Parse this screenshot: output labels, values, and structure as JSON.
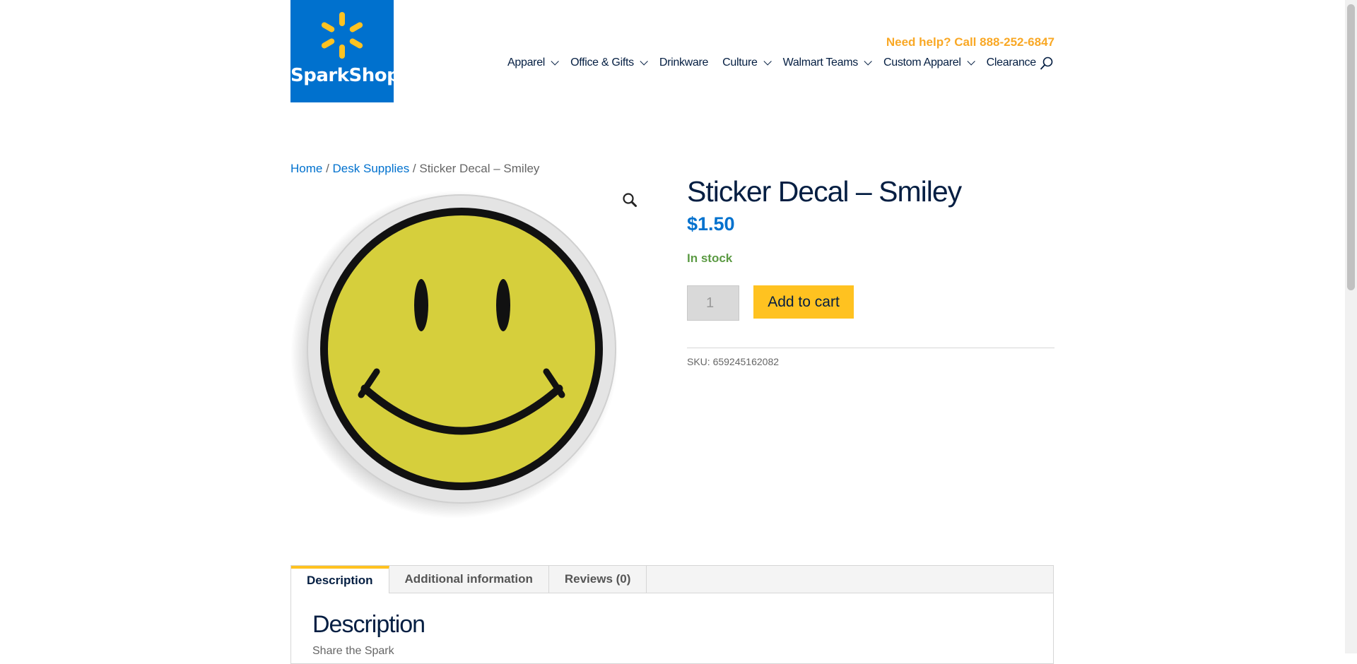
{
  "brand": {
    "name": "SparkShop",
    "color": "#0071ce",
    "spark_color": "#ffc220"
  },
  "header": {
    "help_text": "Need help? Call 888-252-6847",
    "nav": [
      {
        "label": "Apparel",
        "dropdown": true
      },
      {
        "label": "Office & Gifts",
        "dropdown": true
      },
      {
        "label": "Drinkware",
        "dropdown": false
      },
      {
        "label": "Culture",
        "dropdown": true
      },
      {
        "label": "Walmart Teams",
        "dropdown": true
      },
      {
        "label": "Custom Apparel",
        "dropdown": true
      },
      {
        "label": "Clearance",
        "dropdown": false
      }
    ],
    "search_icon": "search-icon"
  },
  "breadcrumb": {
    "home": "Home",
    "sep": " / ",
    "category": "Desk Supplies",
    "current": "Sticker Decal – Smiley"
  },
  "product": {
    "title": "Sticker Decal – Smiley",
    "price": "$1.50",
    "stock": "In stock",
    "quantity": "1",
    "add_to_cart": "Add to cart",
    "sku_label": "SKU:",
    "sku": "659245162082",
    "zoom_icon": "magnifier-icon"
  },
  "tabs": [
    {
      "label": "Description",
      "active": true
    },
    {
      "label": "Additional information",
      "active": false
    },
    {
      "label": "Reviews (0)",
      "active": false
    }
  ],
  "description": {
    "heading": "Description",
    "text": "Share the Spark"
  }
}
